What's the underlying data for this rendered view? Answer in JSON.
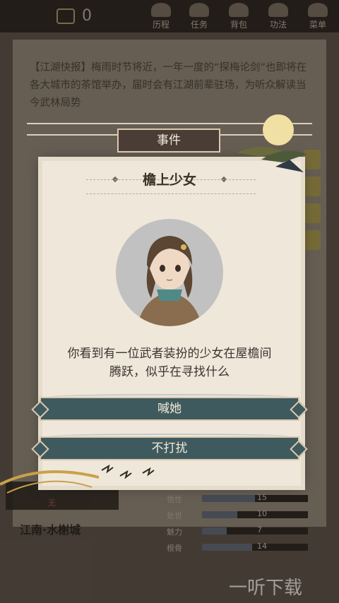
{
  "topbar": {
    "coin_value": "0",
    "menu": [
      {
        "label": "历程",
        "icon": "journey-icon"
      },
      {
        "label": "任务",
        "icon": "task-icon"
      },
      {
        "label": "背包",
        "icon": "bag-icon"
      },
      {
        "label": "功法",
        "icon": "skill-icon"
      },
      {
        "label": "菜单",
        "icon": "menu-icon"
      }
    ]
  },
  "news": {
    "text": "【江湖快报】梅雨时节将近，一年一度的“探梅论剑”也即将在各大城市的茶馆举办，届时会有江湖前辈驻场，为听众解读当今武林局势"
  },
  "background": {
    "left_label": "无",
    "location": "江南·水榭城",
    "stats": [
      {
        "label": "悟性",
        "value": "15",
        "fraction": 0.5
      },
      {
        "label": "处世",
        "value": "10",
        "fraction": 0.33
      },
      {
        "label": "魅力",
        "value": "7",
        "fraction": 0.23
      },
      {
        "label": "根骨",
        "value": "14",
        "fraction": 0.47
      }
    ]
  },
  "dialog": {
    "category": "事件",
    "title": "檐上少女",
    "description": "你看到有一位武者装扮的少女在屋檐间腾跃，似乎在寻找什么",
    "options": [
      "喊她",
      "不打扰"
    ]
  },
  "watermark": "一听下载",
  "colors": {
    "option_bg": "#3f5a5e",
    "plate_bg": "#4a3d36",
    "paper": "#efe7da",
    "accent_gold": "#c7b75e"
  }
}
